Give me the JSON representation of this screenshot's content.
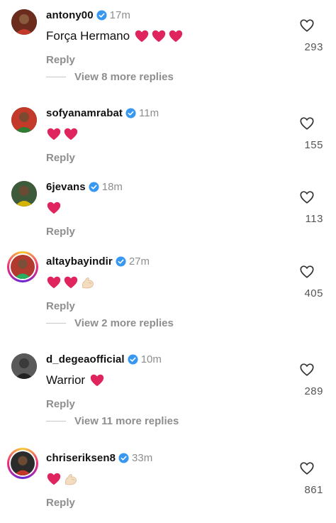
{
  "colors": {
    "heart_red": "#e0245e",
    "verified_blue": "#3897f0",
    "muted_gray": "#8e8e8e"
  },
  "comments": [
    {
      "username": "antony00",
      "time": "17m",
      "text": "Força Hermano",
      "emojis": [
        "red-heart",
        "red-heart",
        "red-heart"
      ],
      "reply_label": "Reply",
      "likes": "293",
      "view_replies": "View 8 more replies"
    },
    {
      "username": "sofyanamrabat",
      "time": "11m",
      "text": "",
      "emojis": [
        "red-heart",
        "red-heart"
      ],
      "reply_label": "Reply",
      "likes": "155",
      "view_replies": ""
    },
    {
      "username": "6jevans",
      "time": "18m",
      "text": "",
      "emojis": [
        "red-heart"
      ],
      "reply_label": "Reply",
      "likes": "113",
      "view_replies": ""
    },
    {
      "username": "altaybayindir",
      "time": "27m",
      "text": "",
      "emojis": [
        "red-heart",
        "red-heart",
        "flexed-biceps"
      ],
      "reply_label": "Reply",
      "likes": "405",
      "view_replies": "View 2 more replies"
    },
    {
      "username": "d_degeaofficial",
      "time": "10m",
      "text": "Warrior",
      "emojis": [
        "red-heart"
      ],
      "reply_label": "Reply",
      "likes": "289",
      "view_replies": "View 11 more replies"
    },
    {
      "username": "chriseriksen8",
      "time": "33m",
      "text": "",
      "emojis": [
        "red-heart",
        "flexed-biceps"
      ],
      "reply_label": "Reply",
      "likes": "861",
      "view_replies": ""
    }
  ]
}
